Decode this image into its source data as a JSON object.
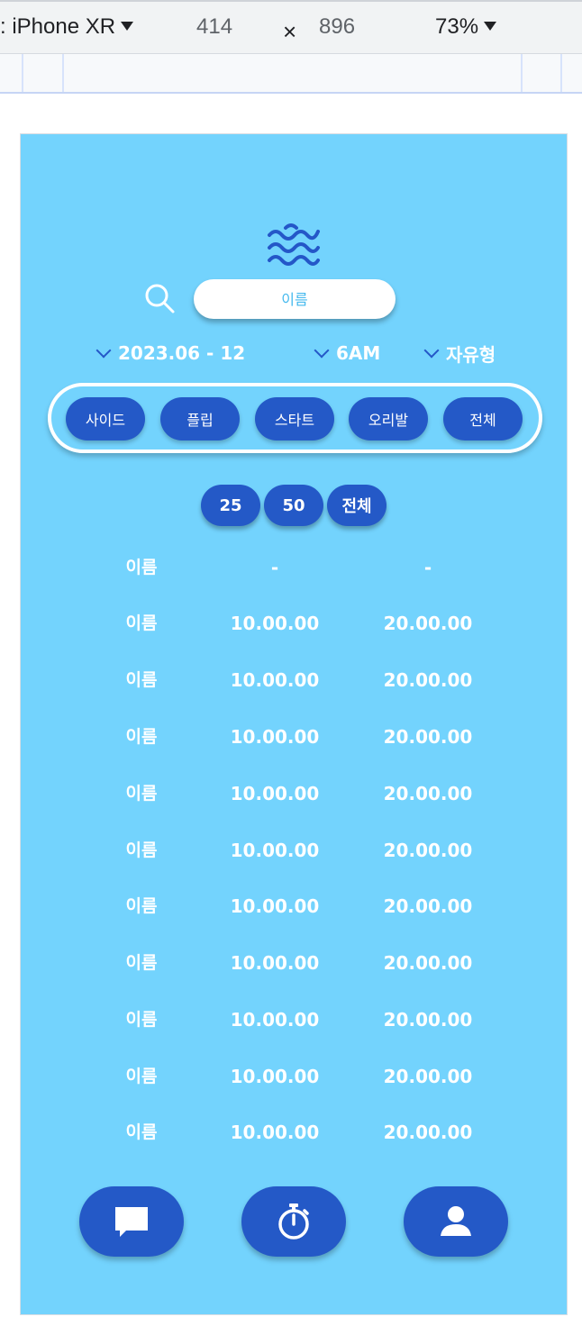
{
  "devtools": {
    "device": ": iPhone XR",
    "width": "414",
    "times": "×",
    "height": "896",
    "zoom": "73%"
  },
  "app": {
    "search": {
      "placeholder": "이름"
    },
    "filters": [
      {
        "label": "2023.06 - 12"
      },
      {
        "label": "6AM"
      },
      {
        "label": "자유형"
      }
    ],
    "strokes": [
      {
        "label": "사이드"
      },
      {
        "label": "플립"
      },
      {
        "label": "스타트"
      },
      {
        "label": "오리발"
      },
      {
        "label": "전체"
      }
    ],
    "counts": [
      {
        "label": "25"
      },
      {
        "label": "50"
      },
      {
        "label": "전체"
      }
    ],
    "records": [
      {
        "name": "이름",
        "time1": "-",
        "time2": "-"
      },
      {
        "name": "이름",
        "time1": "10.00.00",
        "time2": "20.00.00"
      },
      {
        "name": "이름",
        "time1": "10.00.00",
        "time2": "20.00.00"
      },
      {
        "name": "이름",
        "time1": "10.00.00",
        "time2": "20.00.00"
      },
      {
        "name": "이름",
        "time1": "10.00.00",
        "time2": "20.00.00"
      },
      {
        "name": "이름",
        "time1": "10.00.00",
        "time2": "20.00.00"
      },
      {
        "name": "이름",
        "time1": "10.00.00",
        "time2": "20.00.00"
      },
      {
        "name": "이름",
        "time1": "10.00.00",
        "time2": "20.00.00"
      },
      {
        "name": "이름",
        "time1": "10.00.00",
        "time2": "20.00.00"
      },
      {
        "name": "이름",
        "time1": "10.00.00",
        "time2": "20.00.00"
      },
      {
        "name": "이름",
        "time1": "10.00.00",
        "time2": "20.00.00"
      }
    ],
    "nav": [
      {
        "icon": "chat-bubble-icon"
      },
      {
        "icon": "stopwatch-icon"
      },
      {
        "icon": "user-profile-icon"
      }
    ],
    "colors": {
      "background": "#73d3fd",
      "accent": "#2459c7",
      "text": "#ffffff"
    }
  }
}
